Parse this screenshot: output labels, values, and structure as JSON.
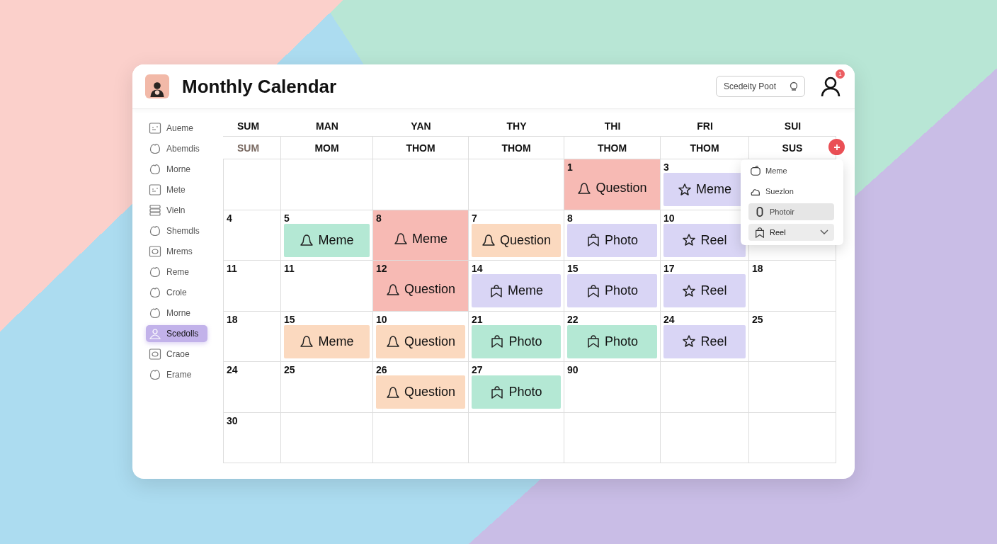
{
  "window": {
    "title": "Monthly Calendar"
  },
  "search": {
    "placeholder": "Scedeity Poot"
  },
  "notifications": {
    "badge": "1"
  },
  "sidebar": {
    "items": [
      {
        "label": "Aueme",
        "kind": "card",
        "selected": false
      },
      {
        "label": "Abemdis",
        "kind": "blob",
        "selected": false
      },
      {
        "label": "Morne",
        "kind": "blob",
        "selected": false
      },
      {
        "label": "Mete",
        "kind": "card",
        "selected": false
      },
      {
        "label": "Vieln",
        "kind": "list",
        "selected": false
      },
      {
        "label": "Shemdls",
        "kind": "blob",
        "selected": false
      },
      {
        "label": "Mrems",
        "kind": "square",
        "selected": false
      },
      {
        "label": "Reme",
        "kind": "blob",
        "selected": false
      },
      {
        "label": "Crole",
        "kind": "blob",
        "selected": false
      },
      {
        "label": "Morne",
        "kind": "blob",
        "selected": false
      },
      {
        "label": "Scedolls",
        "kind": "person",
        "selected": true
      },
      {
        "label": "Craoe",
        "kind": "square",
        "selected": false
      },
      {
        "label": "Erame",
        "kind": "blob",
        "selected": false
      }
    ]
  },
  "calendar": {
    "day_names": [
      "SUM",
      "MAN",
      "YAN",
      "THY",
      "THI",
      "FRI",
      "SUI"
    ],
    "sub_headers": [
      {
        "label": "SUM",
        "muted": true
      },
      {
        "label": "MOM",
        "muted": false
      },
      {
        "label": "THOM",
        "muted": false
      },
      {
        "label": "THOM",
        "muted": false
      },
      {
        "label": "THOM",
        "muted": false
      },
      {
        "label": "THOM",
        "muted": false
      },
      {
        "label": "SUS",
        "muted": false
      }
    ],
    "weeks": [
      [
        {
          "kind": "blank"
        },
        {
          "kind": "blank"
        },
        {
          "kind": "blank"
        },
        {
          "kind": "blank"
        },
        {
          "kind": "day",
          "date": "1",
          "event": {
            "label": "Question",
            "kind": "bell",
            "color": "#f7bab4",
            "full": true
          }
        },
        {
          "kind": "day",
          "date": "3",
          "event": {
            "label": "Meme",
            "kind": "star",
            "color": "#d9d5f5",
            "full": false
          }
        },
        {
          "kind": "blank"
        }
      ],
      [
        {
          "kind": "day",
          "date": "4"
        },
        {
          "kind": "day",
          "date": "5",
          "event": {
            "label": "Meme",
            "kind": "bell",
            "color": "#b4e8d4",
            "full": false
          }
        },
        {
          "kind": "day",
          "date": "8",
          "event": {
            "label": "Meme",
            "kind": "bell",
            "color": "#f7bab4",
            "full": true
          }
        },
        {
          "kind": "day",
          "date": "7",
          "event": {
            "label": "Question",
            "kind": "bell",
            "color": "#fbd9bf",
            "full": false
          }
        },
        {
          "kind": "day",
          "date": "8",
          "event": {
            "label": "Photo",
            "kind": "bag",
            "color": "#d9d5f5",
            "full": false
          }
        },
        {
          "kind": "day",
          "date": "10",
          "event": {
            "label": "Reel",
            "kind": "star",
            "color": "#d9d5f5",
            "full": false
          }
        },
        {
          "kind": "blank"
        }
      ],
      [
        {
          "kind": "day",
          "date": "11"
        },
        {
          "kind": "day",
          "date": "11"
        },
        {
          "kind": "day",
          "date": "12",
          "event": {
            "label": "Question",
            "kind": "bell",
            "color": "#f7bab4",
            "full": true
          }
        },
        {
          "kind": "day",
          "date": "14",
          "event": {
            "label": "Meme",
            "kind": "bag",
            "color": "#d9d5f5",
            "full": false
          }
        },
        {
          "kind": "day",
          "date": "15",
          "event": {
            "label": "Photo",
            "kind": "bag",
            "color": "#d9d5f5",
            "full": false
          }
        },
        {
          "kind": "day",
          "date": "17",
          "event": {
            "label": "Reel",
            "kind": "star",
            "color": "#d9d5f5",
            "full": false
          }
        },
        {
          "kind": "day",
          "date": "18"
        }
      ],
      [
        {
          "kind": "day",
          "date": "18"
        },
        {
          "kind": "day",
          "date": "15",
          "event": {
            "label": "Meme",
            "kind": "bell",
            "color": "#fbd9bf",
            "full": false
          }
        },
        {
          "kind": "day",
          "date": "10",
          "event": {
            "label": "Question",
            "kind": "bell",
            "color": "#fbd9bf",
            "full": false
          }
        },
        {
          "kind": "day",
          "date": "21",
          "event": {
            "label": "Photo",
            "kind": "bag",
            "color": "#b4e8d4",
            "full": false
          }
        },
        {
          "kind": "day",
          "date": "22",
          "event": {
            "label": "Photo",
            "kind": "bag",
            "color": "#b4e8d4",
            "full": false
          }
        },
        {
          "kind": "day",
          "date": "24",
          "event": {
            "label": "Reel",
            "kind": "star",
            "color": "#d9d5f5",
            "full": false
          }
        },
        {
          "kind": "day",
          "date": "25"
        }
      ],
      [
        {
          "kind": "day",
          "date": "24"
        },
        {
          "kind": "day",
          "date": "25"
        },
        {
          "kind": "day",
          "date": "26",
          "event": {
            "label": "Question",
            "kind": "bell",
            "color": "#fbd9bf",
            "full": false
          }
        },
        {
          "kind": "day",
          "date": "27",
          "event": {
            "label": "Photo",
            "kind": "bag",
            "color": "#b4e8d4",
            "full": false
          }
        },
        {
          "kind": "day",
          "date": "90"
        },
        {
          "kind": "blank"
        },
        {
          "kind": "blank"
        }
      ],
      [
        {
          "kind": "day",
          "date": "30"
        },
        {
          "kind": "blank"
        },
        {
          "kind": "blank"
        },
        {
          "kind": "blank"
        },
        {
          "kind": "blank"
        },
        {
          "kind": "blank"
        },
        {
          "kind": "blank"
        }
      ]
    ]
  },
  "type_menu": {
    "items": [
      {
        "label": "Meme",
        "kind": "item",
        "selected": false
      },
      {
        "label": "Suezlon",
        "kind": "item",
        "selected": false
      },
      {
        "label": "Photoir",
        "kind": "item",
        "selected": true
      },
      {
        "label": "Reel",
        "kind": "select",
        "selected": false
      }
    ]
  }
}
